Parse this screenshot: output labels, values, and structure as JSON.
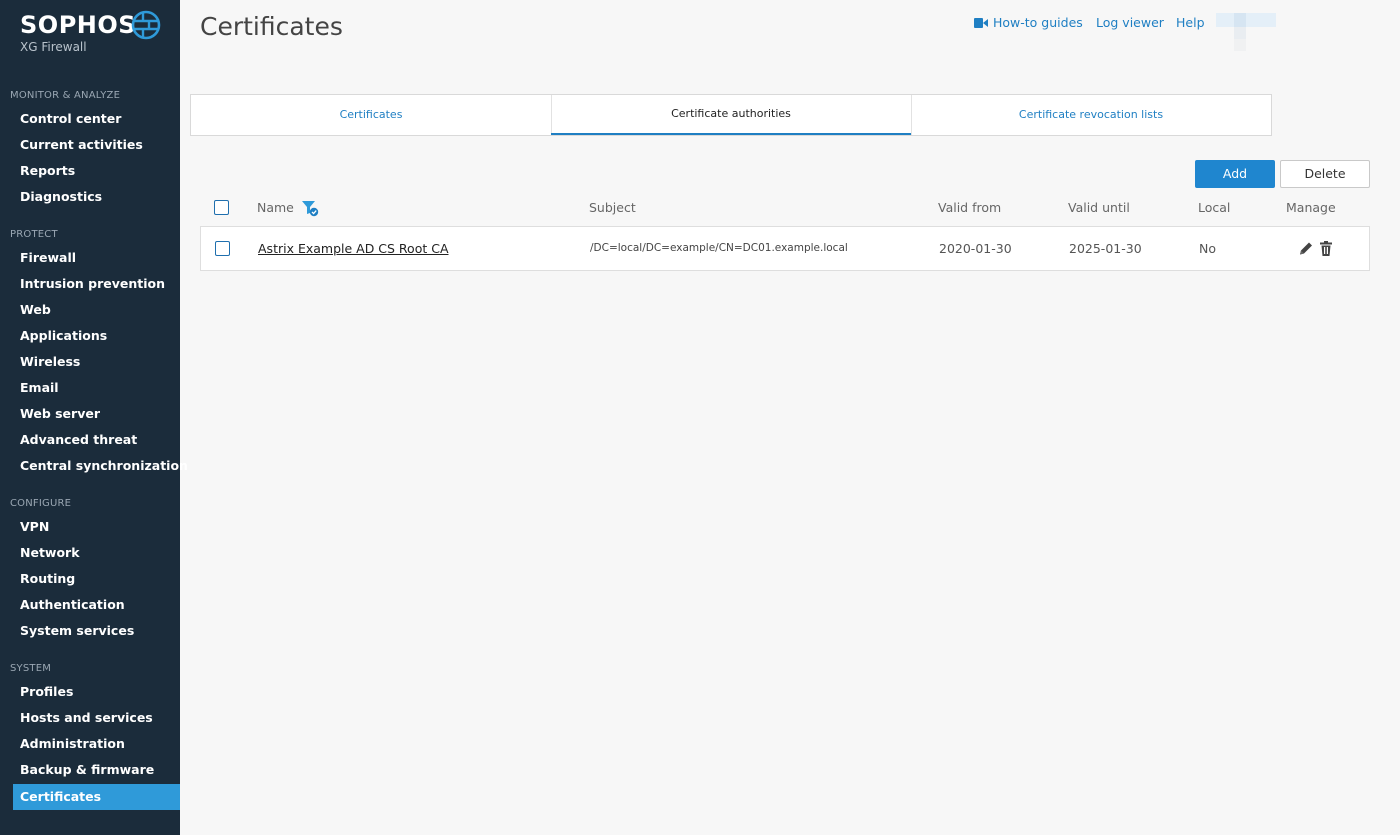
{
  "brand": {
    "name": "SOPHOS",
    "product": "XG Firewall"
  },
  "sidebar": {
    "sections": [
      {
        "title": "MONITOR & ANALYZE",
        "items": [
          "Control center",
          "Current activities",
          "Reports",
          "Diagnostics"
        ]
      },
      {
        "title": "PROTECT",
        "items": [
          "Firewall",
          "Intrusion prevention",
          "Web",
          "Applications",
          "Wireless",
          "Email",
          "Web server",
          "Advanced threat",
          "Central synchronization"
        ]
      },
      {
        "title": "CONFIGURE",
        "items": [
          "VPN",
          "Network",
          "Routing",
          "Authentication",
          "System services"
        ]
      },
      {
        "title": "SYSTEM",
        "items": [
          "Profiles",
          "Hosts and services",
          "Administration",
          "Backup & firmware",
          "Certificates"
        ]
      }
    ],
    "active_item": "Certificates"
  },
  "header": {
    "title": "Certificates",
    "links": {
      "howto": "How-to guides",
      "log_viewer": "Log viewer",
      "help": "Help"
    }
  },
  "tabs": [
    "Certificates",
    "Certificate authorities",
    "Certificate revocation lists"
  ],
  "active_tab": "Certificate authorities",
  "toolbar": {
    "add_label": "Add",
    "delete_label": "Delete"
  },
  "table": {
    "columns": {
      "name": "Name",
      "subject": "Subject",
      "valid_from": "Valid from",
      "valid_until": "Valid until",
      "local": "Local",
      "manage": "Manage"
    },
    "rows": [
      {
        "name": "Astrix Example AD CS Root CA",
        "subject": "/DC=local/DC=example/CN=DC01.example.local",
        "valid_from": "2020-01-30",
        "valid_until": "2025-01-30",
        "local": "No"
      }
    ]
  },
  "colors": {
    "sidebar_bg": "#1b2c3b",
    "accent": "#2f9ad9",
    "link": "#1f7fc3",
    "button": "#1f86cf"
  }
}
